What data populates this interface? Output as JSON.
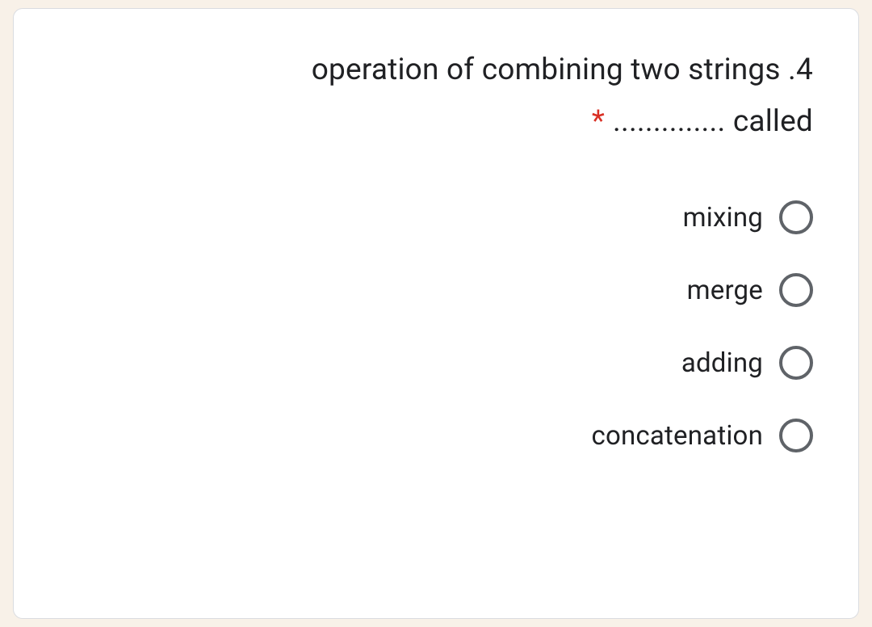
{
  "question": {
    "line1": "operation of combining two strings .4",
    "line2_dots": "..............",
    "line2_text": " called",
    "required_marker": "*"
  },
  "options": [
    {
      "label": "mixing"
    },
    {
      "label": "merge"
    },
    {
      "label": "adding"
    },
    {
      "label": "concatenation"
    }
  ]
}
